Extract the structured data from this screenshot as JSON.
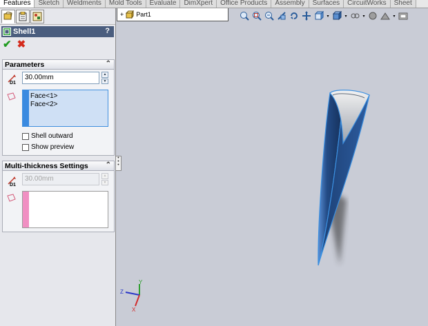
{
  "command_tabs": [
    "Features",
    "Sketch",
    "Weldments",
    "Mold Tools",
    "Evaluate",
    "DimXpert",
    "Office Products",
    "Assembly",
    "Surfaces",
    "CircuitWorks",
    "Sheet"
  ],
  "tree": {
    "expand": "+",
    "part_name": "Part1"
  },
  "property_manager": {
    "title": "Shell1",
    "help": "?",
    "ok_symbol": "✔",
    "cancel_symbol": "✖",
    "parameters": {
      "header": "Parameters",
      "collapse": "⌃",
      "thickness": "30.00mm",
      "faces": [
        "Face<1>",
        "Face<2>"
      ],
      "shell_outward": "Shell outward",
      "show_preview": "Show preview"
    },
    "multi_thickness": {
      "header": "Multi-thickness Settings",
      "collapse": "⌃",
      "thickness": "30.00mm"
    }
  },
  "triad": {
    "x": "X",
    "y": "Y",
    "z": "Z"
  },
  "colors": {
    "title_bar": "#4a5d7e",
    "active_list": "#cfe0f5",
    "list_bar_blue": "#3a8ae0",
    "list_bar_pink": "#f08fc2",
    "model_blue": "#1c3f73",
    "model_edge": "#3b8fe0"
  }
}
